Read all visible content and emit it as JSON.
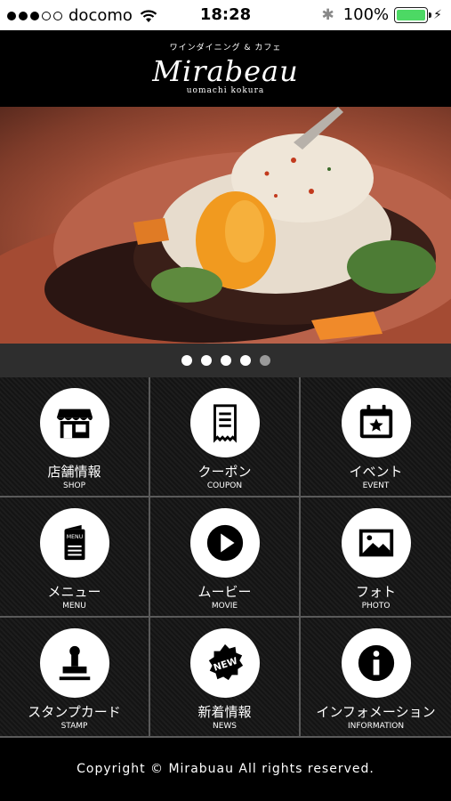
{
  "status_bar": {
    "carrier": "docomo",
    "time": "18:28",
    "battery": "100%",
    "signal_bars_filled": 3,
    "signal_bars_total": 5,
    "battery_level": 1.0,
    "battery_color": "#4cd964"
  },
  "header": {
    "kana": "ワインダイニング & カフェ",
    "logo": "Mirabeau",
    "location": "uomachi kokura"
  },
  "hero": {
    "slide_count": 5,
    "active_slide": 4
  },
  "menu": [
    {
      "jp": "店舗情報",
      "en": "SHOP",
      "icon": "shop-icon"
    },
    {
      "jp": "クーポン",
      "en": "COUPON",
      "icon": "coupon-icon"
    },
    {
      "jp": "イベント",
      "en": "EVENT",
      "icon": "event-calendar-icon"
    },
    {
      "jp": "メニュー",
      "en": "MENU",
      "icon": "menu-book-icon",
      "icon_text": "MENU"
    },
    {
      "jp": "ムービー",
      "en": "MOVIE",
      "icon": "play-icon"
    },
    {
      "jp": "フォト",
      "en": "PHOTO",
      "icon": "photo-icon"
    },
    {
      "jp": "スタンプカード",
      "en": "STAMP",
      "icon": "stamp-icon"
    },
    {
      "jp": "新着情報",
      "en": "NEWS",
      "icon": "news-badge-icon",
      "icon_text": "NEW"
    },
    {
      "jp": "インフォメーション",
      "en": "INFORMATION",
      "icon": "info-icon"
    }
  ],
  "footer": {
    "copyright": "Copyright © Mirabuau All rights reserved."
  }
}
